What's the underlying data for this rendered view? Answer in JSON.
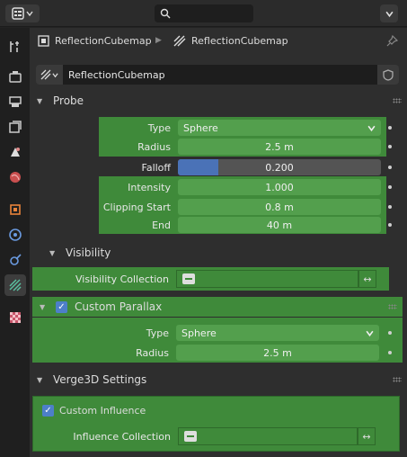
{
  "header": {
    "object_name": "ReflectionCubemap",
    "data_name": "ReflectionCubemap",
    "datablock_name": "ReflectionCubemap"
  },
  "probe": {
    "title": "Probe",
    "type_label": "Type",
    "type_value": "Sphere",
    "radius_label": "Radius",
    "radius_value": "2.5 m",
    "falloff_label": "Falloff",
    "falloff_value": "0.200",
    "falloff_fraction": 0.2,
    "intensity_label": "Intensity",
    "intensity_value": "1.000",
    "clip_start_label": "Clipping Start",
    "clip_start_value": "0.8 m",
    "end_label": "End",
    "end_value": "40 m"
  },
  "visibility": {
    "title": "Visibility",
    "collection_label": "Visibility Collection",
    "collection_value": ""
  },
  "parallax": {
    "title": "Custom Parallax",
    "checked": true,
    "type_label": "Type",
    "type_value": "Sphere",
    "radius_label": "Radius",
    "radius_value": "2.5 m"
  },
  "verge": {
    "title": "Verge3D Settings",
    "custom_influence_label": "Custom Influence",
    "custom_influence_checked": true,
    "influence_collection_label": "Influence Collection",
    "influence_collection_value": ""
  },
  "colors": {
    "green": "#3f8a3a",
    "field_green": "#539f4d",
    "accent_blue": "#4a72b7"
  }
}
